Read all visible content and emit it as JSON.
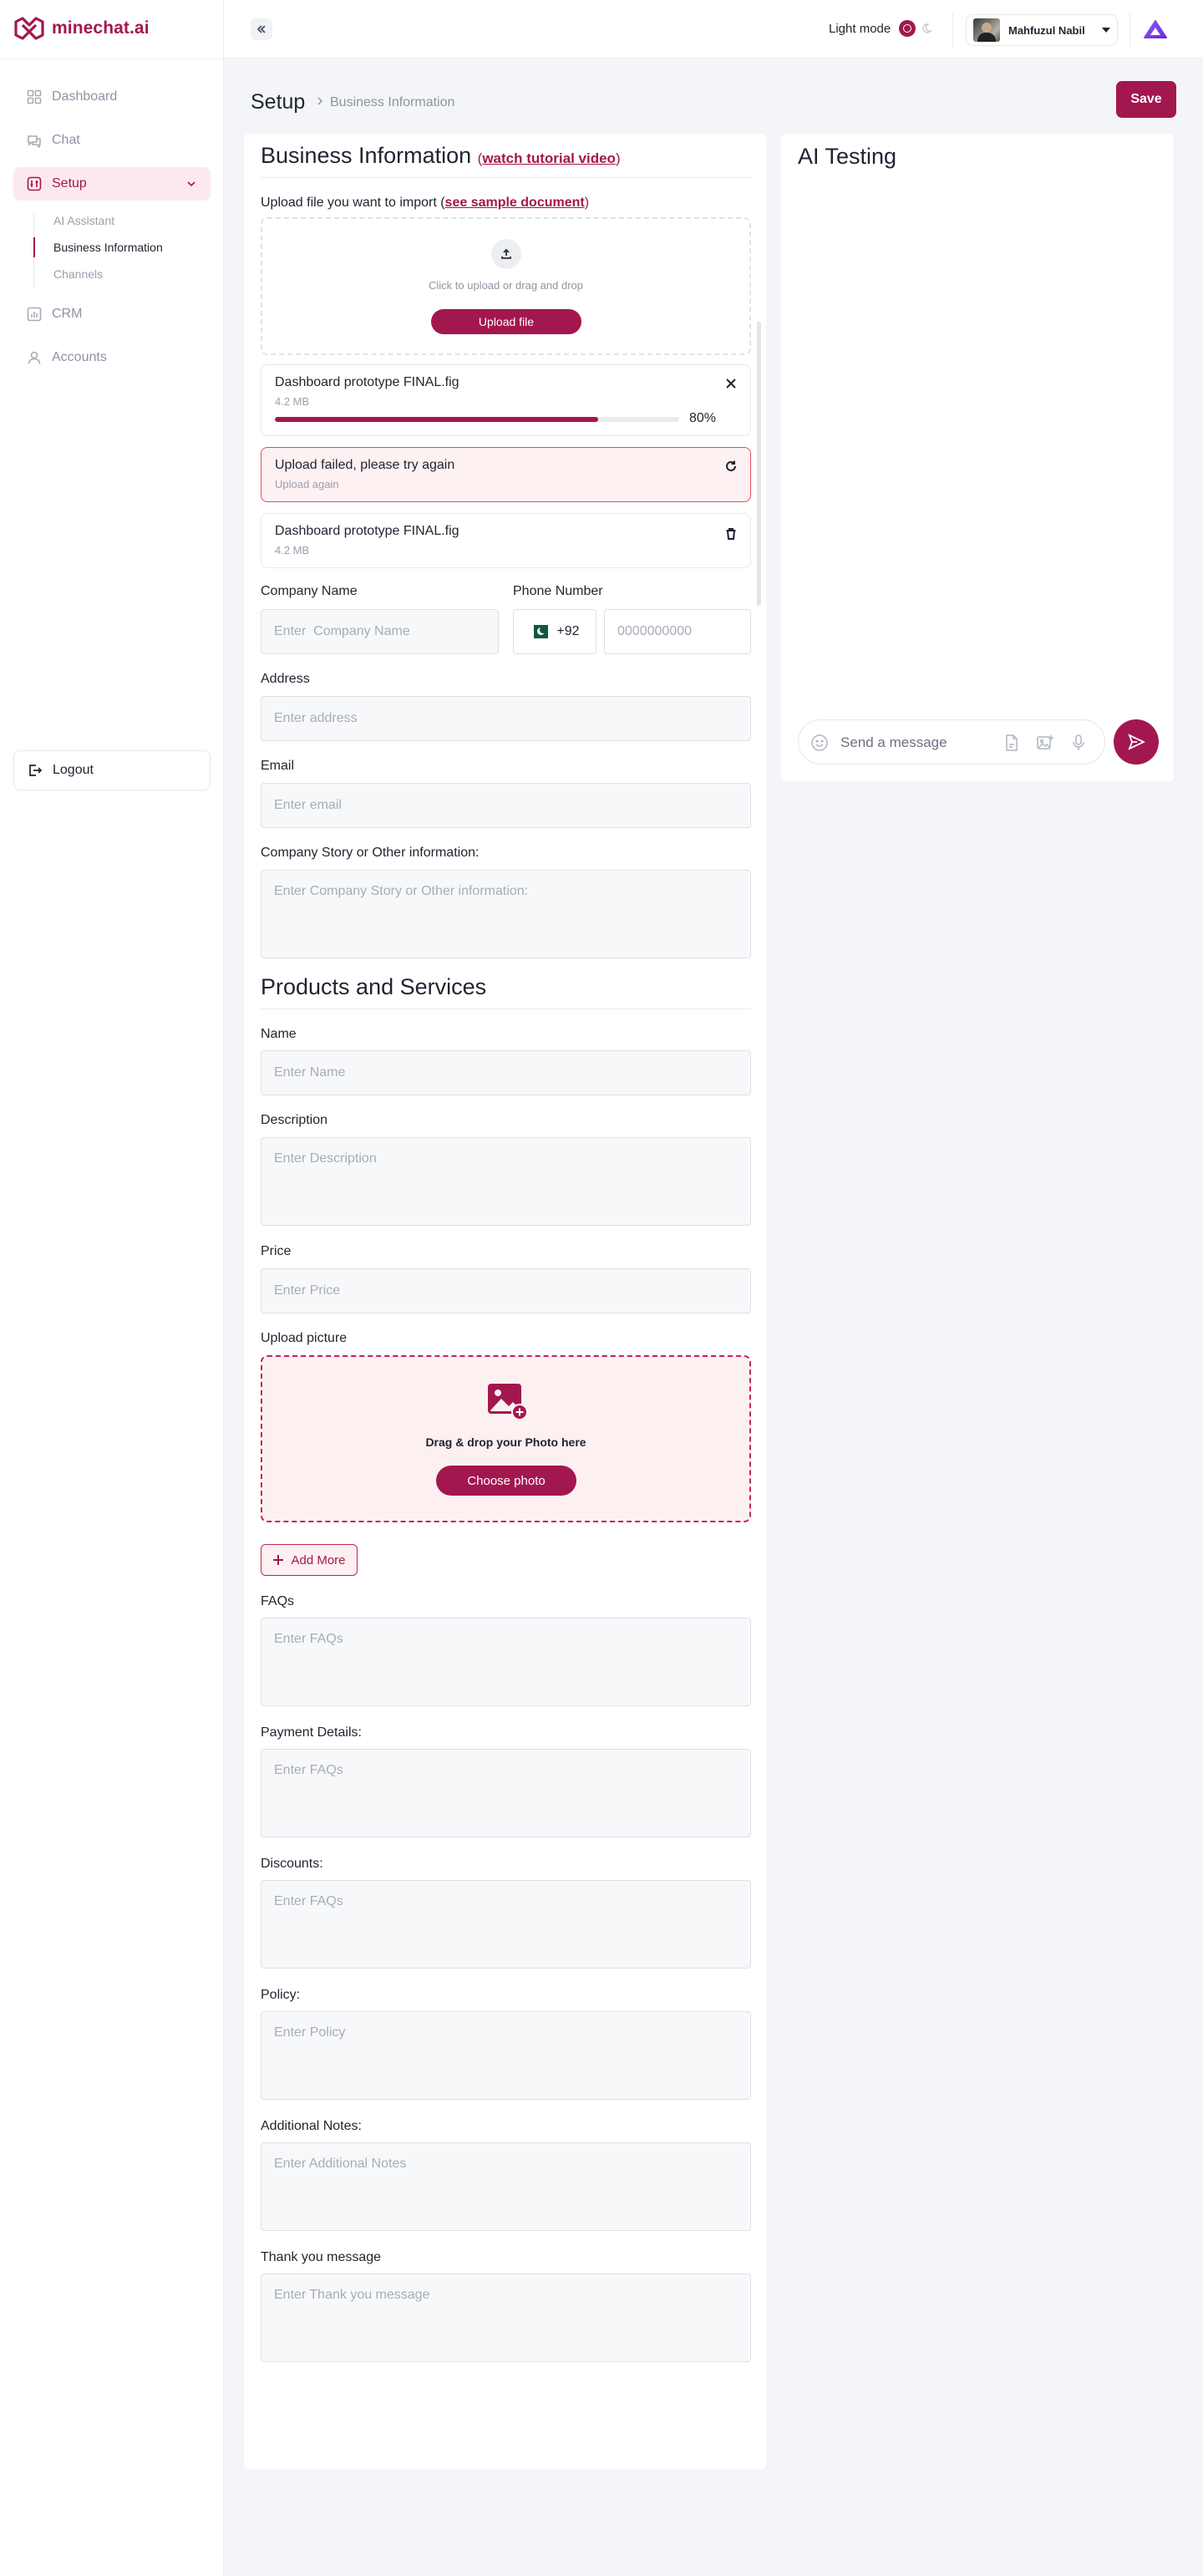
{
  "brand": {
    "name": "minechat.ai",
    "accent": "#a3174f"
  },
  "sidebar": {
    "items": [
      {
        "label": "Dashboard",
        "icon": "grid-icon"
      },
      {
        "label": "Chat",
        "icon": "chat-icon"
      },
      {
        "label": "Setup",
        "icon": "setup-icon",
        "expanded": true
      },
      {
        "label": "CRM",
        "icon": "bar-chart-icon"
      },
      {
        "label": "Accounts",
        "icon": "user-icon"
      }
    ],
    "subitems": [
      "AI Assistant",
      "Business Information",
      "Channels"
    ],
    "active_subitem": "Business Information",
    "logout_label": "Logout"
  },
  "topbar": {
    "mode_label": "Light mode",
    "user_name": "Mahfuzul Nabil"
  },
  "page": {
    "title": "Setup",
    "breadcrumb": "Business Information",
    "save_label": "Save"
  },
  "business": {
    "title": "Business Information",
    "tutorial_link": "watch tutorial video",
    "upload_label_prefix": "Upload file you want to import (",
    "sample_link": "see sample document",
    "upload_label_suffix": ")",
    "dropzone_text": "Click to upload or drag and drop",
    "upload_button": "Upload file",
    "files": [
      {
        "name": "Dashboard prototype FINAL.fig",
        "size": "4.2 MB",
        "progress": 80,
        "progress_label": "80%"
      },
      {
        "name": "Dashboard prototype FINAL.fig",
        "size": "4.2 MB"
      }
    ],
    "error": {
      "title": "Upload failed, please try again",
      "action": "Upload again"
    },
    "fields": {
      "company_name": {
        "label": "Company Name",
        "placeholder": "Enter  Company Name"
      },
      "phone": {
        "label": "Phone Number",
        "country_code": "+92",
        "placeholder": "0000000000"
      },
      "address": {
        "label": "Address",
        "placeholder": "Enter address"
      },
      "email": {
        "label": "Email",
        "placeholder": "Enter email"
      },
      "story": {
        "label": "Company Story or Other information:",
        "placeholder": "Enter Company Story or Other information:"
      }
    }
  },
  "products": {
    "title": "Products and Services",
    "name": {
      "label": "Name",
      "placeholder": "Enter Name"
    },
    "description": {
      "label": "Description",
      "placeholder": "Enter Description"
    },
    "price": {
      "label": "Price",
      "placeholder": "Enter Price"
    },
    "upload_picture_label": "Upload picture",
    "photo_drop_text": "Drag & drop your Photo here",
    "choose_photo": "Choose photo",
    "add_more": "Add More",
    "faqs": {
      "label": "FAQs",
      "placeholder": "Enter FAQs"
    },
    "payment": {
      "label": "Payment Details:",
      "placeholder": "Enter FAQs"
    },
    "discounts": {
      "label": "Discounts:",
      "placeholder": "Enter FAQs"
    },
    "policy": {
      "label": "Policy:",
      "placeholder": "Enter Policy"
    },
    "notes": {
      "label": "Additional Notes:",
      "placeholder": "Enter Additional Notes"
    },
    "thanks": {
      "label": "Thank you message",
      "placeholder": "Enter Thank you message"
    }
  },
  "ai_testing": {
    "title": "AI Testing",
    "message_placeholder": "Send a message"
  }
}
